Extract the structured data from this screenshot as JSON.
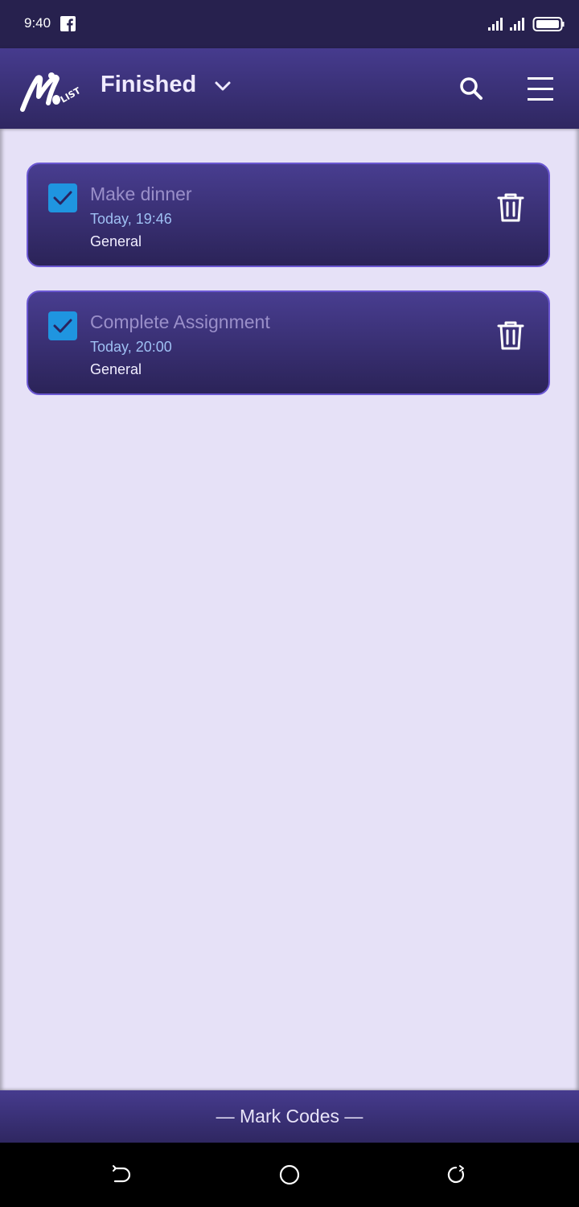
{
  "status_bar": {
    "time": "9:40",
    "icons": [
      "facebook-icon",
      "signal-icon",
      "signal-icon",
      "battery-icon"
    ]
  },
  "app_bar": {
    "logo_text": "LIST",
    "title": "Finished",
    "dropdown_icon": "chevron-down-icon",
    "search_icon": "search-icon",
    "menu_icon": "hamburger-menu-icon"
  },
  "tasks": [
    {
      "title": "Make dinner",
      "time": "Today, 19:46",
      "category": "General",
      "checked": true
    },
    {
      "title": "Complete Assignment",
      "time": "Today, 20:00",
      "category": "General",
      "checked": true
    }
  ],
  "footer": {
    "text": "— Mark Codes —"
  },
  "nav_bar": {
    "icons": [
      "back-icon",
      "home-icon",
      "recent-apps-icon"
    ]
  },
  "colors": {
    "status_bar": "#27214e",
    "app_bar": "#3b3177",
    "content_bg": "#e6e1f7",
    "card_border": "#6b57d2",
    "checkbox": "#1f95e0",
    "task_title": "#9a8fc9",
    "task_time": "#9fc0f3"
  }
}
